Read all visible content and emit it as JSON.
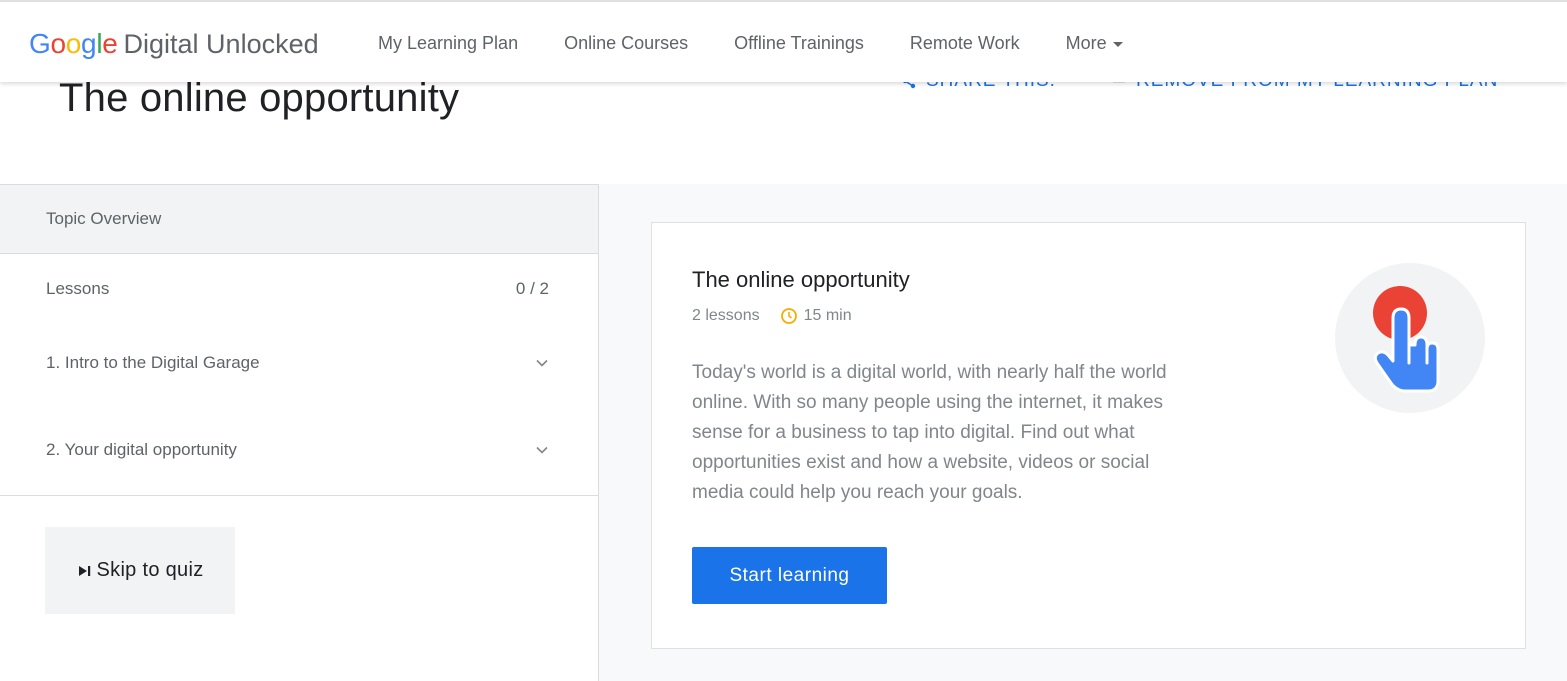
{
  "header": {
    "logo_letters": [
      {
        "ch": "G",
        "color": "#4285F4"
      },
      {
        "ch": "o",
        "color": "#EA4335"
      },
      {
        "ch": "o",
        "color": "#FBBC05"
      },
      {
        "ch": "g",
        "color": "#4285F4"
      },
      {
        "ch": "l",
        "color": "#34A853"
      },
      {
        "ch": "e",
        "color": "#EA4335"
      }
    ],
    "product_name": "Digital Unlocked",
    "nav": {
      "my_learning_plan": "My Learning Plan",
      "online_courses": "Online Courses",
      "offline_trainings": "Offline Trainings",
      "remote_work": "Remote Work",
      "more": "More"
    }
  },
  "page": {
    "title": "The online opportunity",
    "share_label": "Share this:",
    "remove_label": "Remove from my learning plan"
  },
  "sidebar": {
    "topic_overview": "Topic Overview",
    "lessons_label": "Lessons",
    "lessons_progress": "0 / 2",
    "lessons": [
      {
        "label": "1. Intro to the Digital Garage"
      },
      {
        "label": "2. Your digital opportunity"
      }
    ],
    "skip_label": "Skip to quiz"
  },
  "card": {
    "title": "The online opportunity",
    "lesson_count": "2 lessons",
    "duration": "15 min",
    "description": "Today's world is a digital world, with nearly half the world online. With so many people using the internet, it makes sense for a business to tap into digital. Find out what opportunities exist and how a website, videos or social media could help you reach your goals.",
    "cta": "Start learning"
  },
  "colors": {
    "accent": "#1a73e8",
    "illustration_red": "#EA4335",
    "illustration_blue": "#4285F4",
    "clock_yellow": "#F9AB00"
  }
}
